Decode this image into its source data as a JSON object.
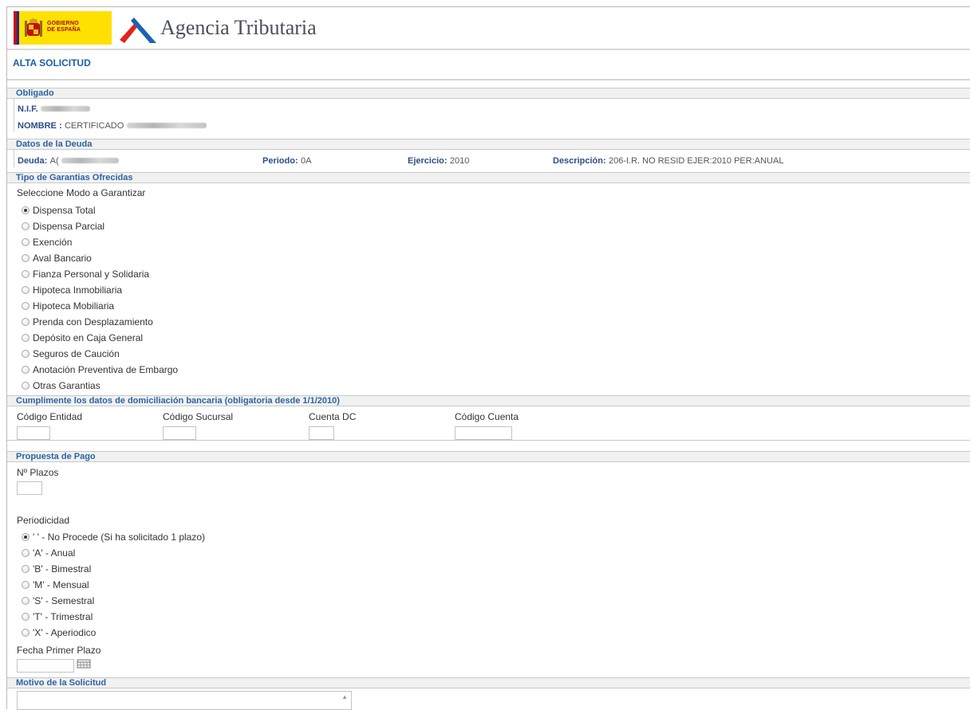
{
  "header": {
    "gobierno_line1": "GOBIERNO",
    "gobierno_line2": "DE ESPAÑA",
    "agency_name": "Agencia Tributaria"
  },
  "page_title": "ALTA SOLICITUD",
  "obligado": {
    "section_title": "Obligado",
    "nif_label": "N.I.F.",
    "nombre_label": "NOMBRE :",
    "nombre_value": "CERTIFICADO"
  },
  "deuda": {
    "section_title": "Datos de la Deuda",
    "deuda_label": "Deuda:",
    "deuda_value": "A(",
    "periodo_label": "Periodo:",
    "periodo_value": "0A",
    "ejercicio_label": "Ejercicio:",
    "ejercicio_value": "2010",
    "descripcion_label": "Descripción:",
    "descripcion_value": "206-I.R. NO RESID EJER:2010 PER:ANUAL"
  },
  "garantias": {
    "section_title": "Tipo de Garantias Ofrecidas",
    "prompt": "Seleccione Modo a Garantizar",
    "options": [
      {
        "label": "Dispensa Total",
        "selected": true
      },
      {
        "label": "Dispensa Parcial",
        "selected": false
      },
      {
        "label": "Exención",
        "selected": false
      },
      {
        "label": "Aval Bancario",
        "selected": false
      },
      {
        "label": "Fianza Personal y Solidaria",
        "selected": false
      },
      {
        "label": "Hipoteca Inmobiliaria",
        "selected": false
      },
      {
        "label": "Hipoteca Mobiliaria",
        "selected": false
      },
      {
        "label": "Prenda con Desplazamiento",
        "selected": false
      },
      {
        "label": "Depósito en Caja General",
        "selected": false
      },
      {
        "label": "Seguros de Caución",
        "selected": false
      },
      {
        "label": "Anotación Preventiva de Embargo",
        "selected": false
      },
      {
        "label": "Otras Garantias",
        "selected": false
      }
    ]
  },
  "domiciliacion": {
    "section_title": "Cumplimente los datos de domiciliación bancaria (obligatoria desde 1/1/2010)",
    "codigo_entidad_label": "Código Entidad",
    "codigo_entidad_value": "",
    "codigo_sucursal_label": "Código Sucursal",
    "codigo_sucursal_value": "",
    "cuenta_dc_label": "Cuenta DC",
    "cuenta_dc_value": "",
    "codigo_cuenta_label": "Código Cuenta",
    "codigo_cuenta_value": ""
  },
  "pago": {
    "section_title": "Propuesta de Pago",
    "plazos_label": "Nº Plazos",
    "plazos_value": "",
    "periodicidad_label": "Periodicidad",
    "periodicidad_options": [
      {
        "label": "' ' - No Procede (Si ha solicitado 1 plazo)",
        "selected": true
      },
      {
        "label": "'A' - Anual",
        "selected": false
      },
      {
        "label": "'B' - Bimestral",
        "selected": false
      },
      {
        "label": "'M' - Mensual",
        "selected": false
      },
      {
        "label": "'S' - Semestral",
        "selected": false
      },
      {
        "label": "'T' - Trimestral",
        "selected": false
      },
      {
        "label": "'X' - Aperiodico",
        "selected": false
      }
    ],
    "fecha_label": "Fecha Primer Plazo",
    "fecha_value": ""
  },
  "motivo": {
    "section_title": "Motivo de la Solicitud",
    "value": ""
  },
  "colors": {
    "section_title": "#2a64a4",
    "label_bold": "#2d4d87",
    "logo_yellow": "#ffe100"
  }
}
